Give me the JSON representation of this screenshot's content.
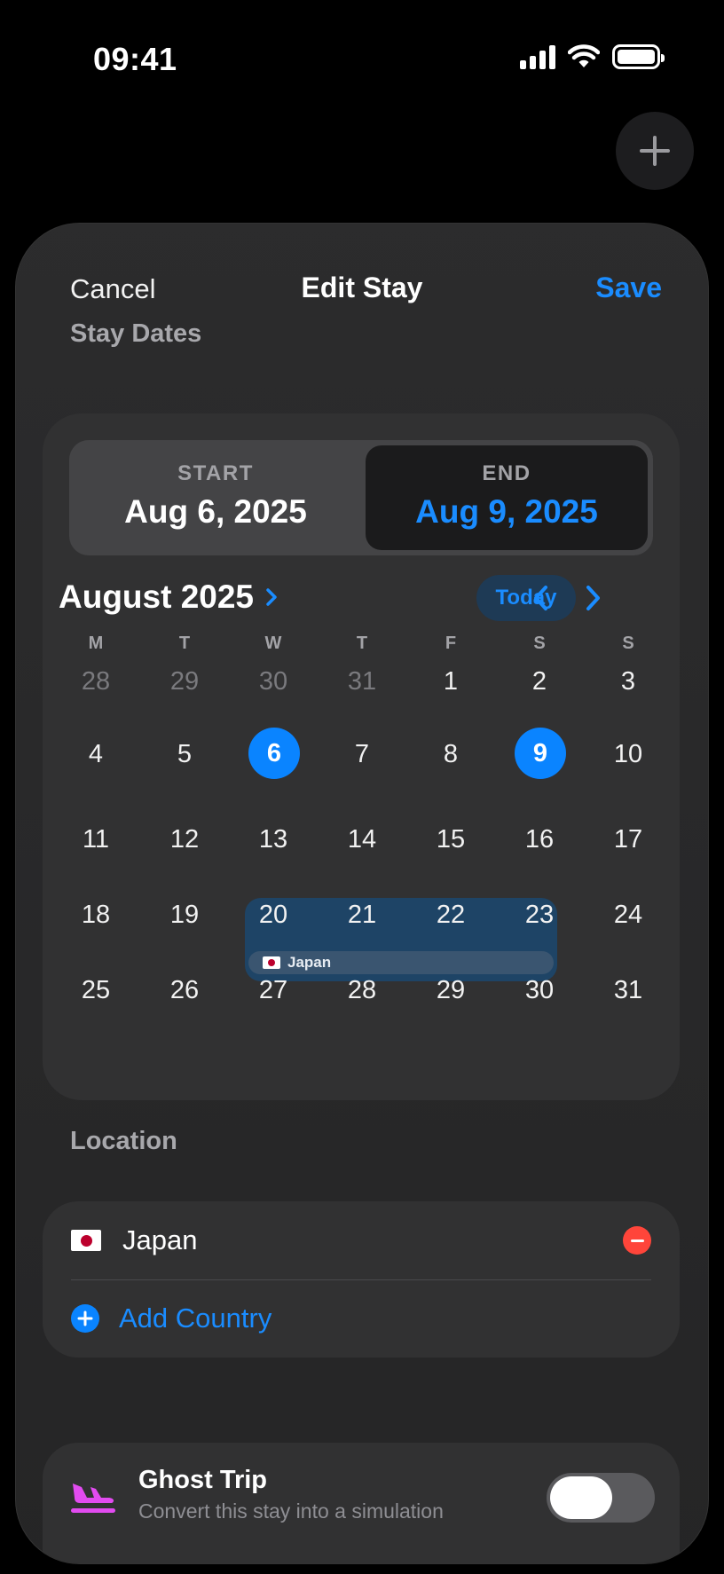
{
  "status_bar": {
    "time": "09:41"
  },
  "nav": {
    "cancel_label": "Cancel",
    "title": "Edit Stay",
    "save_label": "Save"
  },
  "stay_dates": {
    "section_label": "Stay Dates",
    "start": {
      "label": "START",
      "value": "Aug 6, 2025"
    },
    "end": {
      "label": "END",
      "value": "Aug 9, 2025"
    }
  },
  "calendar": {
    "month_title": "August 2025",
    "today_label": "Today",
    "weekdays": [
      "M",
      "T",
      "W",
      "T",
      "F",
      "S",
      "S"
    ],
    "weeks": [
      [
        "28",
        "29",
        "30",
        "31",
        "1",
        "2",
        "3"
      ],
      [
        "4",
        "5",
        "6",
        "7",
        "8",
        "9",
        "10"
      ],
      [
        "11",
        "12",
        "13",
        "14",
        "15",
        "16",
        "17"
      ],
      [
        "18",
        "19",
        "20",
        "21",
        "22",
        "23",
        "24"
      ],
      [
        "25",
        "26",
        "27",
        "28",
        "29",
        "30",
        "31"
      ]
    ],
    "range_label": "Japan",
    "accent_color": "#0a84ff"
  },
  "location": {
    "section_label": "Location",
    "country": "Japan",
    "add_label": "Add Country"
  },
  "ghost_trip": {
    "title": "Ghost Trip",
    "subtitle": "Convert this stay into a simulation",
    "toggle_on": false
  }
}
